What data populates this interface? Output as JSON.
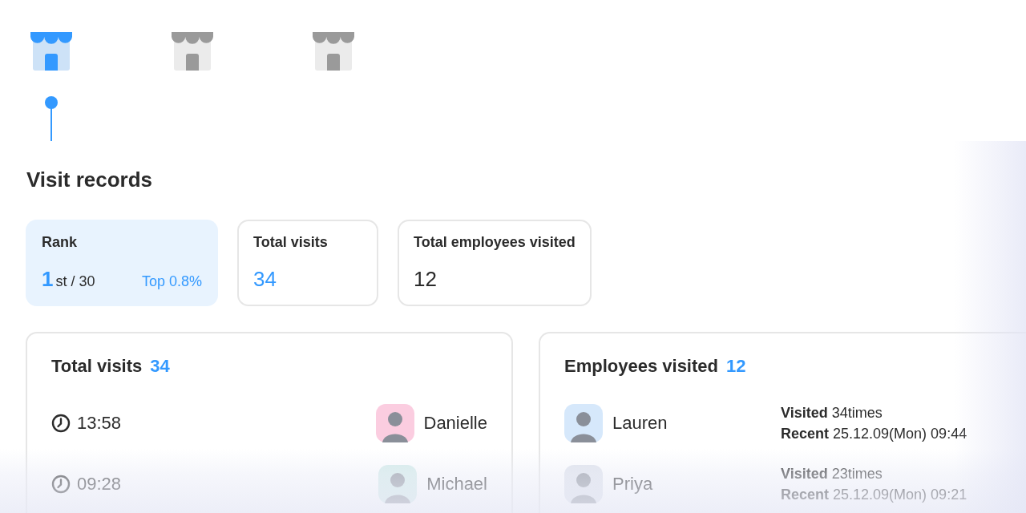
{
  "stores": [
    {
      "selected": true
    },
    {
      "selected": false
    },
    {
      "selected": false
    }
  ],
  "title": "Visit records",
  "stats": {
    "rank": {
      "label": "Rank",
      "number": "1",
      "suffix": "st / 30",
      "top": "Top 0.8%"
    },
    "total_visits": {
      "label": "Total visits",
      "value": "34"
    },
    "total_employees": {
      "label": "Total employees visited",
      "value": "12"
    }
  },
  "visits_panel": {
    "title": "Total visits",
    "count": "34",
    "rows": [
      {
        "time": "13:58",
        "name": "Danielle",
        "color": "#fbcde0"
      },
      {
        "time": "09:28",
        "name": "Michael",
        "color": "#d3ece9"
      }
    ]
  },
  "employees_panel": {
    "title": "Employees visited",
    "count": "12",
    "rows": [
      {
        "name": "Lauren",
        "color": "#d6e8fb",
        "visited_label": "Visited",
        "visited": "34times",
        "recent_label": "Recent",
        "recent": "25.12.09(Mon) 09:44"
      },
      {
        "name": "Priya",
        "color": "#dfe3ec",
        "visited_label": "Visited",
        "visited": "23times",
        "recent_label": "Recent",
        "recent": "25.12.09(Mon) 09:21"
      }
    ]
  }
}
